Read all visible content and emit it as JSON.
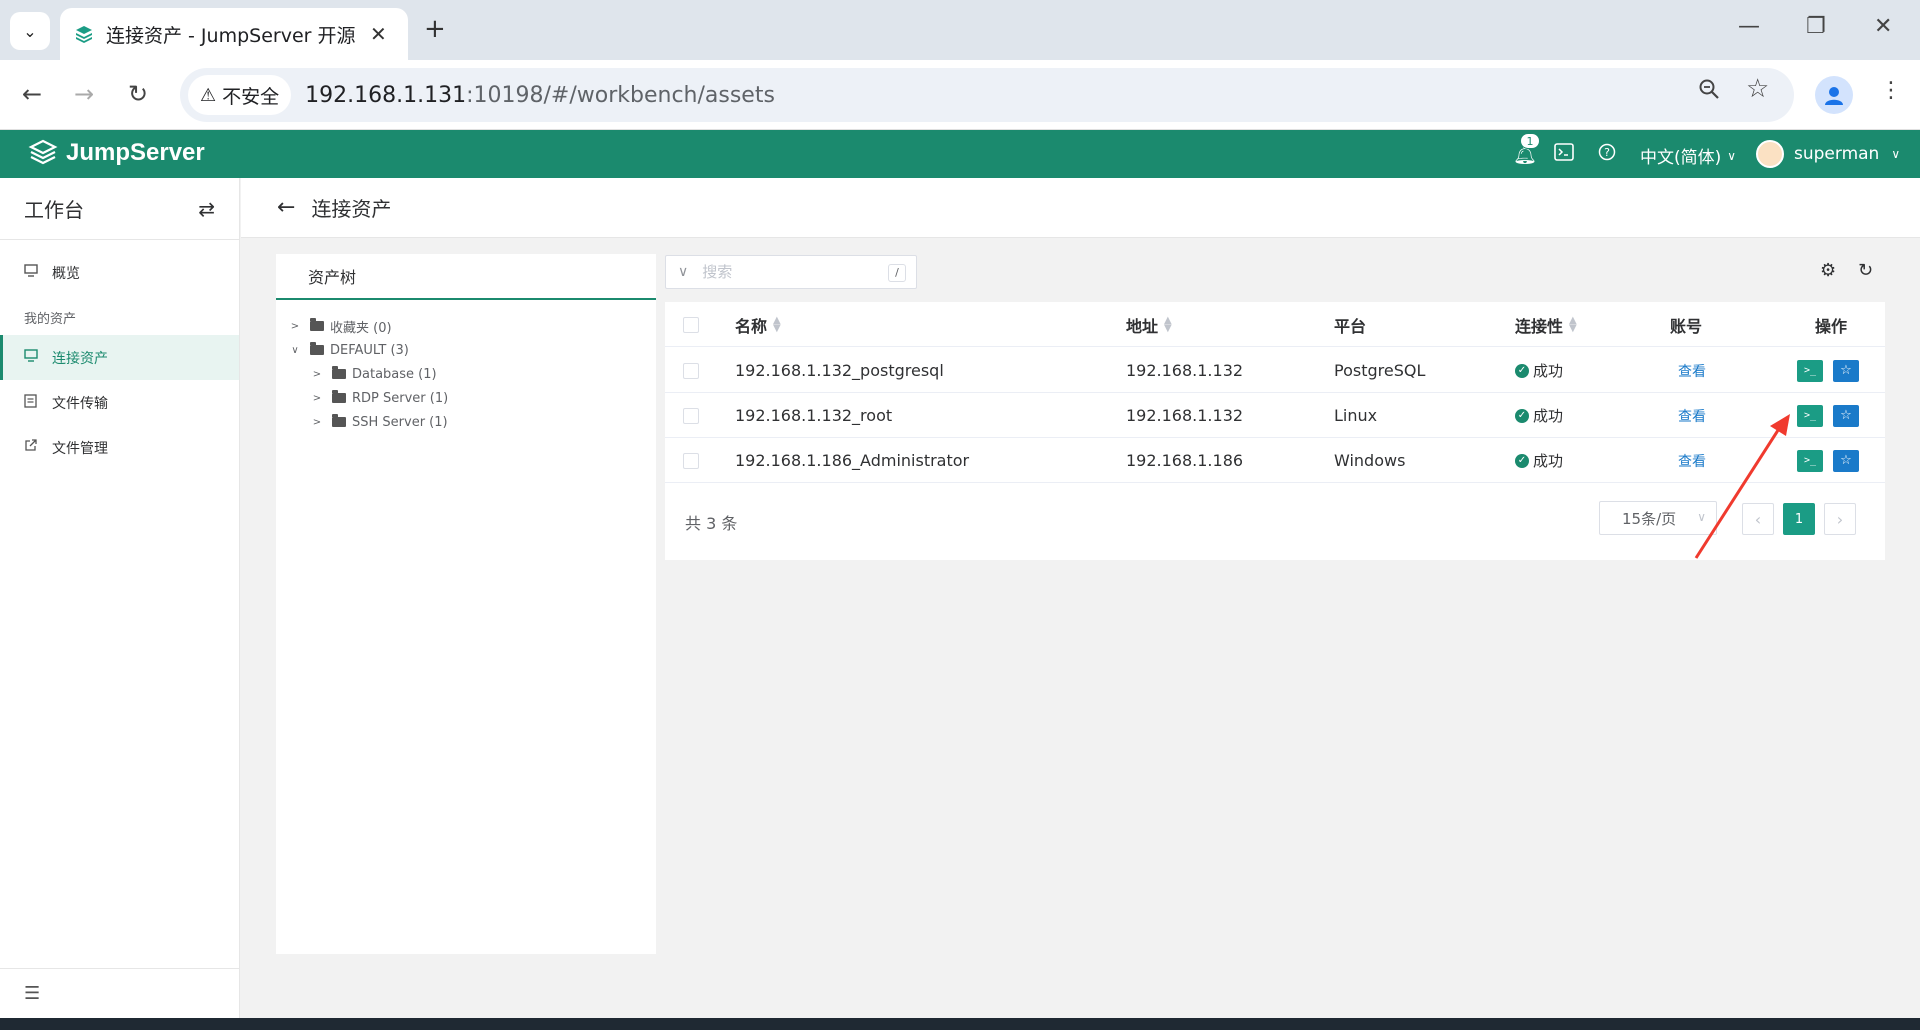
{
  "browser": {
    "tab_title": "连接资产 - JumpServer 开源堡垒机",
    "security_label": "不安全",
    "url_host": "192.168.1.131",
    "url_rest": ":10198/#/workbench/assets",
    "new_tab": "+",
    "close": "✕"
  },
  "header": {
    "brand": "JumpServer",
    "notification_count": "1",
    "language": "中文(简体)",
    "user": "superman",
    "accent_color": "#1b8a6e"
  },
  "sidebar": {
    "title": "工作台",
    "group_label": "我的资产",
    "items": [
      {
        "label": "概览",
        "icon": "monitor-icon"
      },
      {
        "label": "连接资产",
        "icon": "monitor-icon"
      },
      {
        "label": "文件传输",
        "icon": "file-icon"
      },
      {
        "label": "文件管理",
        "icon": "external-link-icon"
      }
    ]
  },
  "page": {
    "title": "连接资产"
  },
  "tree": {
    "tab_label": "资产树",
    "nodes": [
      {
        "label": "收藏夹 (0)",
        "level": 0
      },
      {
        "label": "DEFAULT (3)",
        "level": 0
      },
      {
        "label": "Database (1)",
        "level": 1
      },
      {
        "label": "RDP Server (1)",
        "level": 1
      },
      {
        "label": "SSH Server (1)",
        "level": 1
      }
    ]
  },
  "search": {
    "placeholder": "搜索",
    "shortcut": "/"
  },
  "table": {
    "columns": [
      "名称",
      "地址",
      "平台",
      "连接性",
      "账号",
      "操作"
    ],
    "rows": [
      {
        "name": "192.168.1.132_postgresql",
        "address": "192.168.1.132",
        "platform": "PostgreSQL",
        "connectivity": "成功",
        "account": "查看"
      },
      {
        "name": "192.168.1.132_root",
        "address": "192.168.1.132",
        "platform": "Linux",
        "connectivity": "成功",
        "account": "查看"
      },
      {
        "name": "192.168.1.186_Administrator",
        "address": "192.168.1.186",
        "platform": "Windows",
        "connectivity": "成功",
        "account": "查看"
      }
    ],
    "total": "共 3 条",
    "page_size": "15条/页",
    "current_page": "1"
  }
}
